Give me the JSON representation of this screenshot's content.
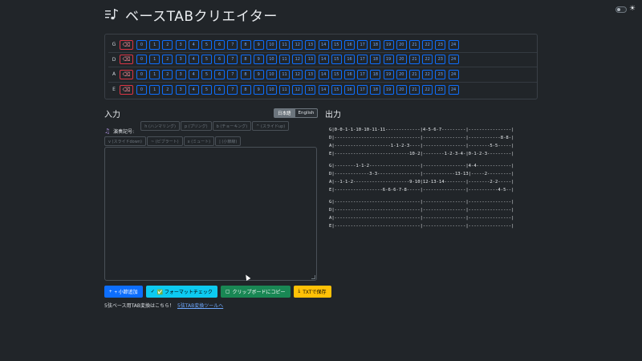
{
  "header": {
    "title": "ベースTABクリエイター",
    "logo_icon": "music-notes-list-icon",
    "theme_icon": "sun-icon"
  },
  "fretboard": {
    "strings": [
      "G",
      "D",
      "A",
      "E"
    ],
    "delete_icon": "backspace-icon",
    "frets": [
      "0",
      "1",
      "2",
      "3",
      "4",
      "5",
      "6",
      "7",
      "8",
      "9",
      "10",
      "11",
      "12",
      "13",
      "14",
      "15",
      "16",
      "17",
      "18",
      "19",
      "20",
      "21",
      "22",
      "23",
      "24"
    ]
  },
  "input": {
    "title": "入力",
    "lang_ja": "日本語",
    "lang_en": "English",
    "symbols_label": "演奏記号:",
    "symbols": [
      "h (ハンマリング)",
      "p (プリング)",
      "b (チョーキング)",
      "^ (スライドup)",
      "v (スライドdown)",
      "~ (ビブラート)",
      "x (ミュート)",
      "| (小節線)"
    ],
    "textarea_value": ""
  },
  "actions": {
    "add_measure": "+ 小節追加",
    "format_check": "✅ フォーマットチェック",
    "copy": "クリップボードにコピー",
    "save_txt": "TXTで保存"
  },
  "footer": {
    "note": "5弦ベース用TAB変換はこちら！",
    "link": "5弦TAB変換ツールへ"
  },
  "output": {
    "title": "出力",
    "blocks": [
      [
        "G|0-0-1-1-10-10-11-11-------------|4-5-6-7---------|----------------|",
        "D|--------------------------------|----------------|------------8-8-|",
        "A|---------------------1-1-2-3----|----------------|--------5-5-----|",
        "E|----------------------------10-2|--------1-2-3-4-|0-1-2-3---------|"
      ],
      [
        "G|--------1-1-2-------------------|----------------|4-4-------------|",
        "D|-------------3-3----------------|------------13-13|-----2---------|",
        "A|--1-1-2---------------------9-10|12-13-14--------|--------2-2-----|",
        "E|------------------6-6-6-7-8-----|----------------|-----------4-5--|"
      ],
      [
        "G|--------------------------------|----------------|----------------|",
        "D|--------------------------------|----------------|----------------|",
        "A|--------------------------------|----------------|----------------|",
        "E|--------------------------------|----------------|----------------|"
      ]
    ]
  }
}
